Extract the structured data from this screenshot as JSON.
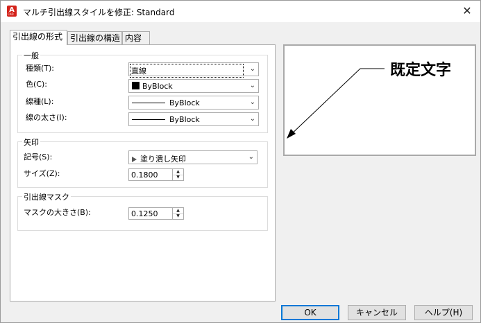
{
  "window": {
    "app_icon_letter": "A",
    "app_icon_sub": "CAD",
    "title": "マルチ引出線スタイルを修正: Standard",
    "close_glyph": "✕"
  },
  "tabs": [
    {
      "label": "引出線の形式",
      "active": true
    },
    {
      "label": "引出線の構造",
      "active": false
    },
    {
      "label": "内容",
      "active": false
    }
  ],
  "general": {
    "legend": "一般",
    "type_label": "種類(T):",
    "type_value": "直線",
    "color_label": "色(C):",
    "color_value": "ByBlock",
    "color_swatch": "#000000",
    "linetype_label": "線種(L):",
    "linetype_value": "ByBlock",
    "lineweight_label": "線の太さ(I):",
    "lineweight_value": "ByBlock"
  },
  "arrowhead": {
    "legend": "矢印",
    "symbol_label": "記号(S):",
    "symbol_value": "塗り潰し矢印",
    "size_label": "サイズ(Z):",
    "size_value": "0.1800"
  },
  "leader_break": {
    "legend": "引出線マスク",
    "mask_label": "マスクの大きさ(B):",
    "mask_value": "0.1250"
  },
  "preview": {
    "text": "既定文字"
  },
  "buttons": {
    "ok": "OK",
    "cancel": "キャンセル",
    "help": "ヘルプ(H)"
  },
  "icons": {
    "dropdown": "chevron-down-icon",
    "spin_up": "spin-up-icon",
    "spin_down": "spin-down-icon",
    "close": "close-icon"
  },
  "colors": {
    "accent": "#0078d7",
    "app_icon": "#d4231b"
  }
}
